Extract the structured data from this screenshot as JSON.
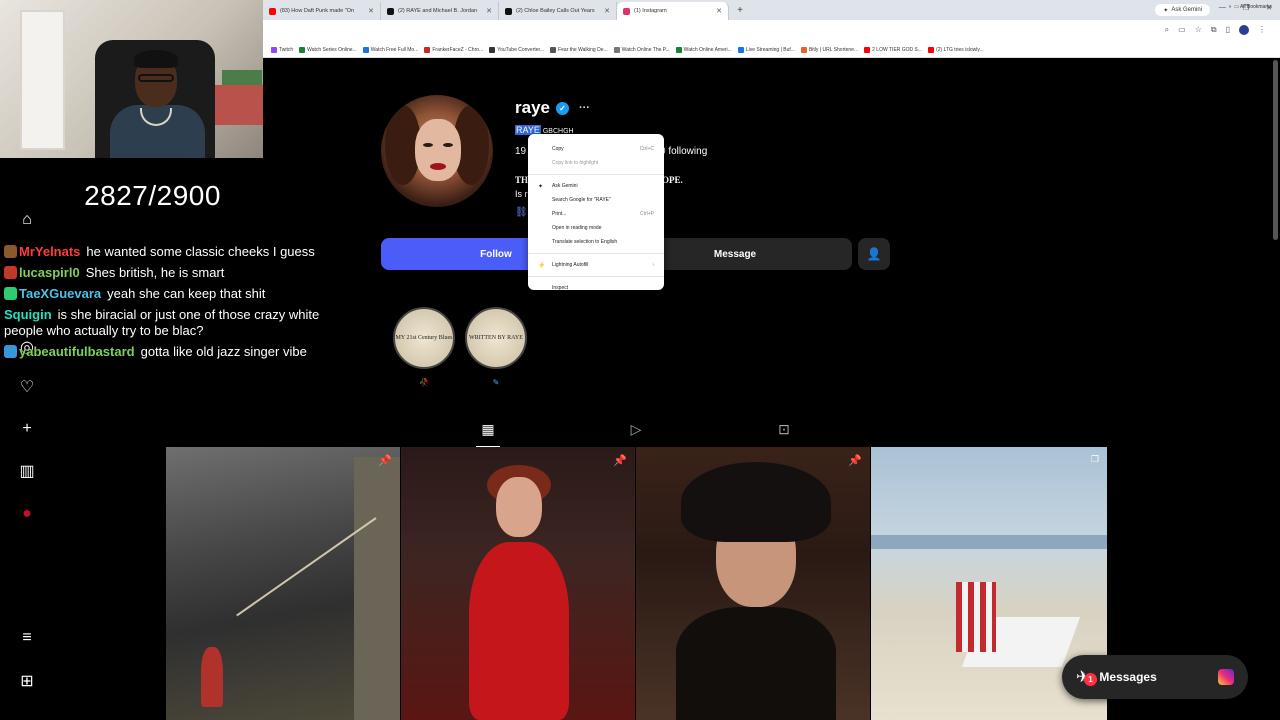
{
  "browser": {
    "tabs": [
      {
        "label": "(83) How Daft Punk made \"On",
        "color": "#ff0000"
      },
      {
        "label": "(2) RAYE and Michael B. Jordan",
        "color": "#111111"
      },
      {
        "label": "(2) Chloe Bailey Calls Out Years",
        "color": "#111111"
      },
      {
        "label": "(1) Instagram",
        "color": "#e1306c"
      }
    ],
    "ask_gemini": "Ask Gemini",
    "bookmarks": [
      {
        "label": "Twitch",
        "color": "#9146ff"
      },
      {
        "label": "Watch Series Online...",
        "color": "#1a7f37"
      },
      {
        "label": "Watch Free Full Mo...",
        "color": "#1a73e8"
      },
      {
        "label": "FrankerFaceZ - Chro...",
        "color": "#c62828"
      },
      {
        "label": "YouTube Converter...",
        "color": "#333333"
      },
      {
        "label": "Fear the Walking De...",
        "color": "#555555"
      },
      {
        "label": "Watch Online The P...",
        "color": "#777777"
      },
      {
        "label": "Watch Online Ameri...",
        "color": "#1a7f37"
      },
      {
        "label": "Live Streaming | Buf...",
        "color": "#1a73e8"
      },
      {
        "label": "Bitly | URL Shortene...",
        "color": "#ee6123"
      },
      {
        "label": "2 LOW TIER GOD S...",
        "color": "#ff0000"
      },
      {
        "label": "(2) LTG tries islowly...",
        "color": "#ff0000"
      }
    ],
    "all_bookmarks": "All Bookmarks"
  },
  "stream": {
    "counter": "2827/2900",
    "chat": [
      {
        "user": "MrYelnats",
        "user_color": "#ff3b3b",
        "badge_color": "#8b5a2b",
        "text": "he wanted some classic cheeks I guess"
      },
      {
        "user": "lucaspirl0",
        "user_color": "#7fd05a",
        "badge_color": "#c0392b",
        "text": "Shes british, he is smart"
      },
      {
        "user": "TaeXGuevara",
        "user_color": "#4fc1e9",
        "badge_color": "#2ecc71",
        "text": "yeah she can keep that shit"
      },
      {
        "user": "Squigin",
        "user_color": "#25e0c0",
        "badge_color": "",
        "text": "is she biracial or just one of those crazy white people who actually try to be blac?"
      },
      {
        "user": "yabeautifulbastard",
        "user_color": "#7fd05a",
        "badge_color": "#3498db",
        "text": "gotta like old jazz singer vibe"
      }
    ]
  },
  "profile": {
    "username": "raye",
    "display_name_selected": "RAYE",
    "display_name_tail": "GBCHGH",
    "stats_left": "19",
    "stats_right": "0 following",
    "bio_line1_left": "TH",
    "bio_line1_right": "OPE.",
    "bio_line2": "Is r",
    "follow_label": "Follow",
    "message_label": "Message",
    "highlights": [
      {
        "text": "MY 21st Century Blues"
      },
      {
        "text": "WRITTEN BY RAYE"
      }
    ]
  },
  "context_menu": {
    "items": [
      {
        "label": "Copy",
        "shortcut": "Ctrl+C",
        "disabled": false,
        "icon": ""
      },
      {
        "label": "Copy link to highlight",
        "shortcut": "",
        "disabled": true,
        "icon": ""
      },
      {
        "label": "Ask Gemini",
        "shortcut": "",
        "disabled": false,
        "icon": "✦"
      },
      {
        "label": "Search Google for \"RAYE\"",
        "shortcut": "",
        "disabled": false,
        "icon": ""
      },
      {
        "label": "Print...",
        "shortcut": "Ctrl+P",
        "disabled": false,
        "icon": ""
      },
      {
        "label": "Open in reading mode",
        "shortcut": "",
        "disabled": false,
        "icon": ""
      },
      {
        "label": "Translate selection to English",
        "shortcut": "",
        "disabled": false,
        "icon": ""
      }
    ],
    "lightning": "Lightning Autofill",
    "inspect": "Inspect"
  },
  "messages": {
    "label": "Messages",
    "badge": "1"
  }
}
